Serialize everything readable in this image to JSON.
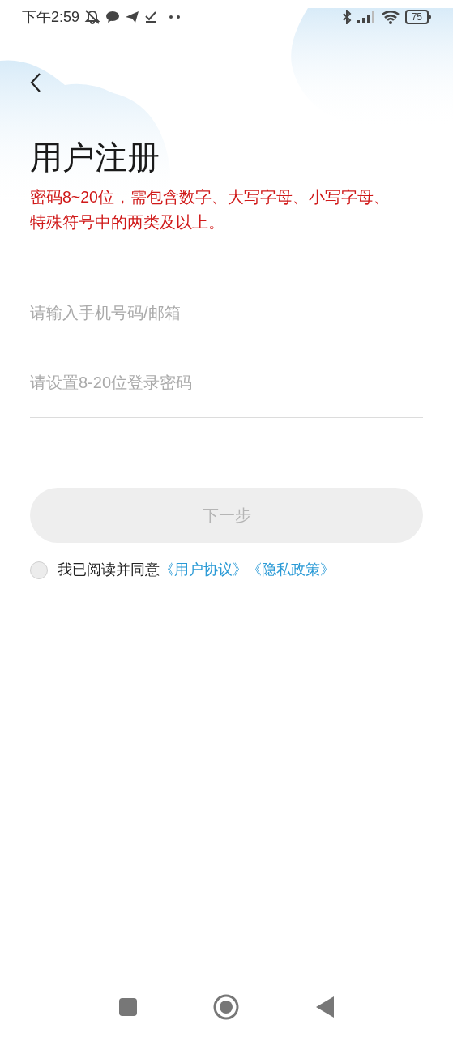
{
  "status_bar": {
    "time": "下午2:59",
    "battery": "75"
  },
  "title": "用户注册",
  "hint": "密码8~20位，需包含数字、大写字母、小写字母、特殊符号中的两类及以上。",
  "fields": [
    {
      "placeholder": "请输入手机号码/邮箱"
    },
    {
      "placeholder": "请设置8-20位登录密码"
    }
  ],
  "next_button": {
    "label": "下一步",
    "disabled": true
  },
  "agreement": {
    "checked": false,
    "text": "我已阅读并同意",
    "links": [
      "《用户协议》",
      "《隐私政策》"
    ]
  }
}
